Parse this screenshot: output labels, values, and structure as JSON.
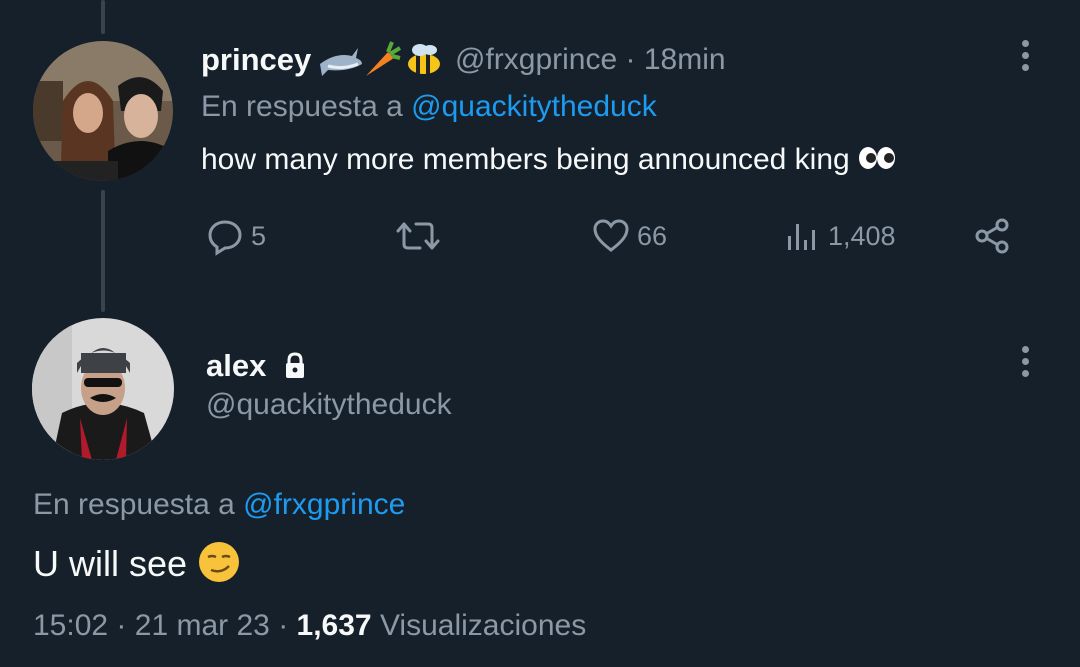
{
  "parent_tweet": {
    "display_name": "princey",
    "name_emojis": [
      "shark-icon",
      "carrot-icon",
      "bee-icon"
    ],
    "handle": "@frxgprince",
    "separator": "·",
    "time_ago": "18min",
    "reply_prefix": "En respuesta a",
    "reply_to": "@quackitytheduck",
    "text": "how many more members being announced king",
    "text_emoji": "eyes-icon",
    "actions": {
      "replies": "5",
      "retweets": "",
      "likes": "66",
      "views": "1,408"
    }
  },
  "main_tweet": {
    "display_name": "alex",
    "badge": "lock-icon",
    "handle": "@quackitytheduck",
    "reply_prefix": "En respuesta a",
    "reply_to": "@frxgprince",
    "text": "U will see",
    "text_emoji": "smirk-icon",
    "time": "15:02",
    "separator": "·",
    "date": "21 mar 23",
    "views_count": "1,637",
    "views_label": "Visualizaciones"
  },
  "colors": {
    "background": "#15202b",
    "text": "#f7f9f9",
    "secondary": "#8b98a5",
    "link": "#1d9bf0",
    "thread_line": "#38444d"
  }
}
